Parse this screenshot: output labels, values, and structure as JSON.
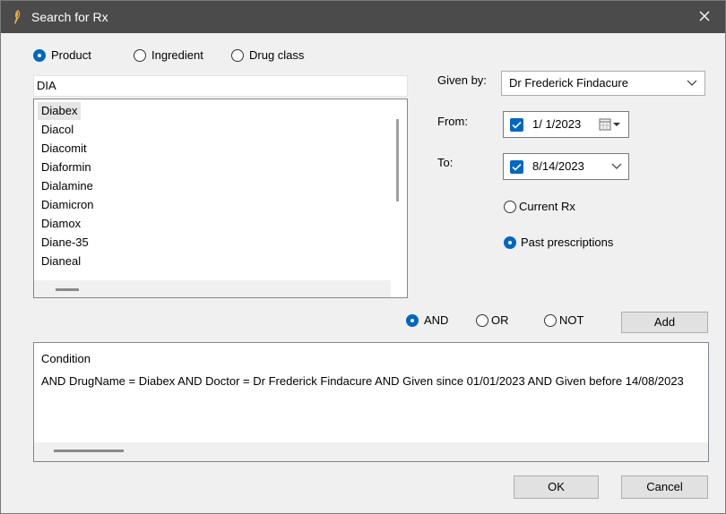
{
  "window": {
    "title": "Search for Rx"
  },
  "search_by": {
    "options": [
      "Product",
      "Ingredient",
      "Drug class"
    ],
    "selected": "Product"
  },
  "search": {
    "value": "DIA"
  },
  "results": {
    "items": [
      "Diabex",
      "Diacol",
      "Diacomit",
      "Diaformin",
      "Dialamine",
      "Diamicron",
      "Diamox",
      "Diane-35",
      "Dianeal"
    ],
    "selected": "Diabex"
  },
  "given_by": {
    "label": "Given by:",
    "value": "Dr Frederick Findacure"
  },
  "from": {
    "label": "From:",
    "value": "1/  1/2023"
  },
  "to": {
    "label": "To:",
    "value": "8/14/2023"
  },
  "rx_scope": {
    "options": [
      "Current Rx",
      "Past prescriptions"
    ],
    "selected": "Past prescriptions"
  },
  "logic": {
    "options": [
      "AND",
      "OR",
      "NOT"
    ],
    "selected": "AND"
  },
  "add_label": "Add",
  "condition": {
    "header": "Condition",
    "text": "AND DrugName = Diabex AND Doctor = Dr Frederick Findacure AND Given since 01/01/2023 AND Given before 14/08/2023"
  },
  "ok_label": "OK",
  "cancel_label": "Cancel",
  "colors": {
    "accent": "#0067c0",
    "titlebar": "#4b4b4b",
    "dialog_bg": "#f0f0f0"
  }
}
